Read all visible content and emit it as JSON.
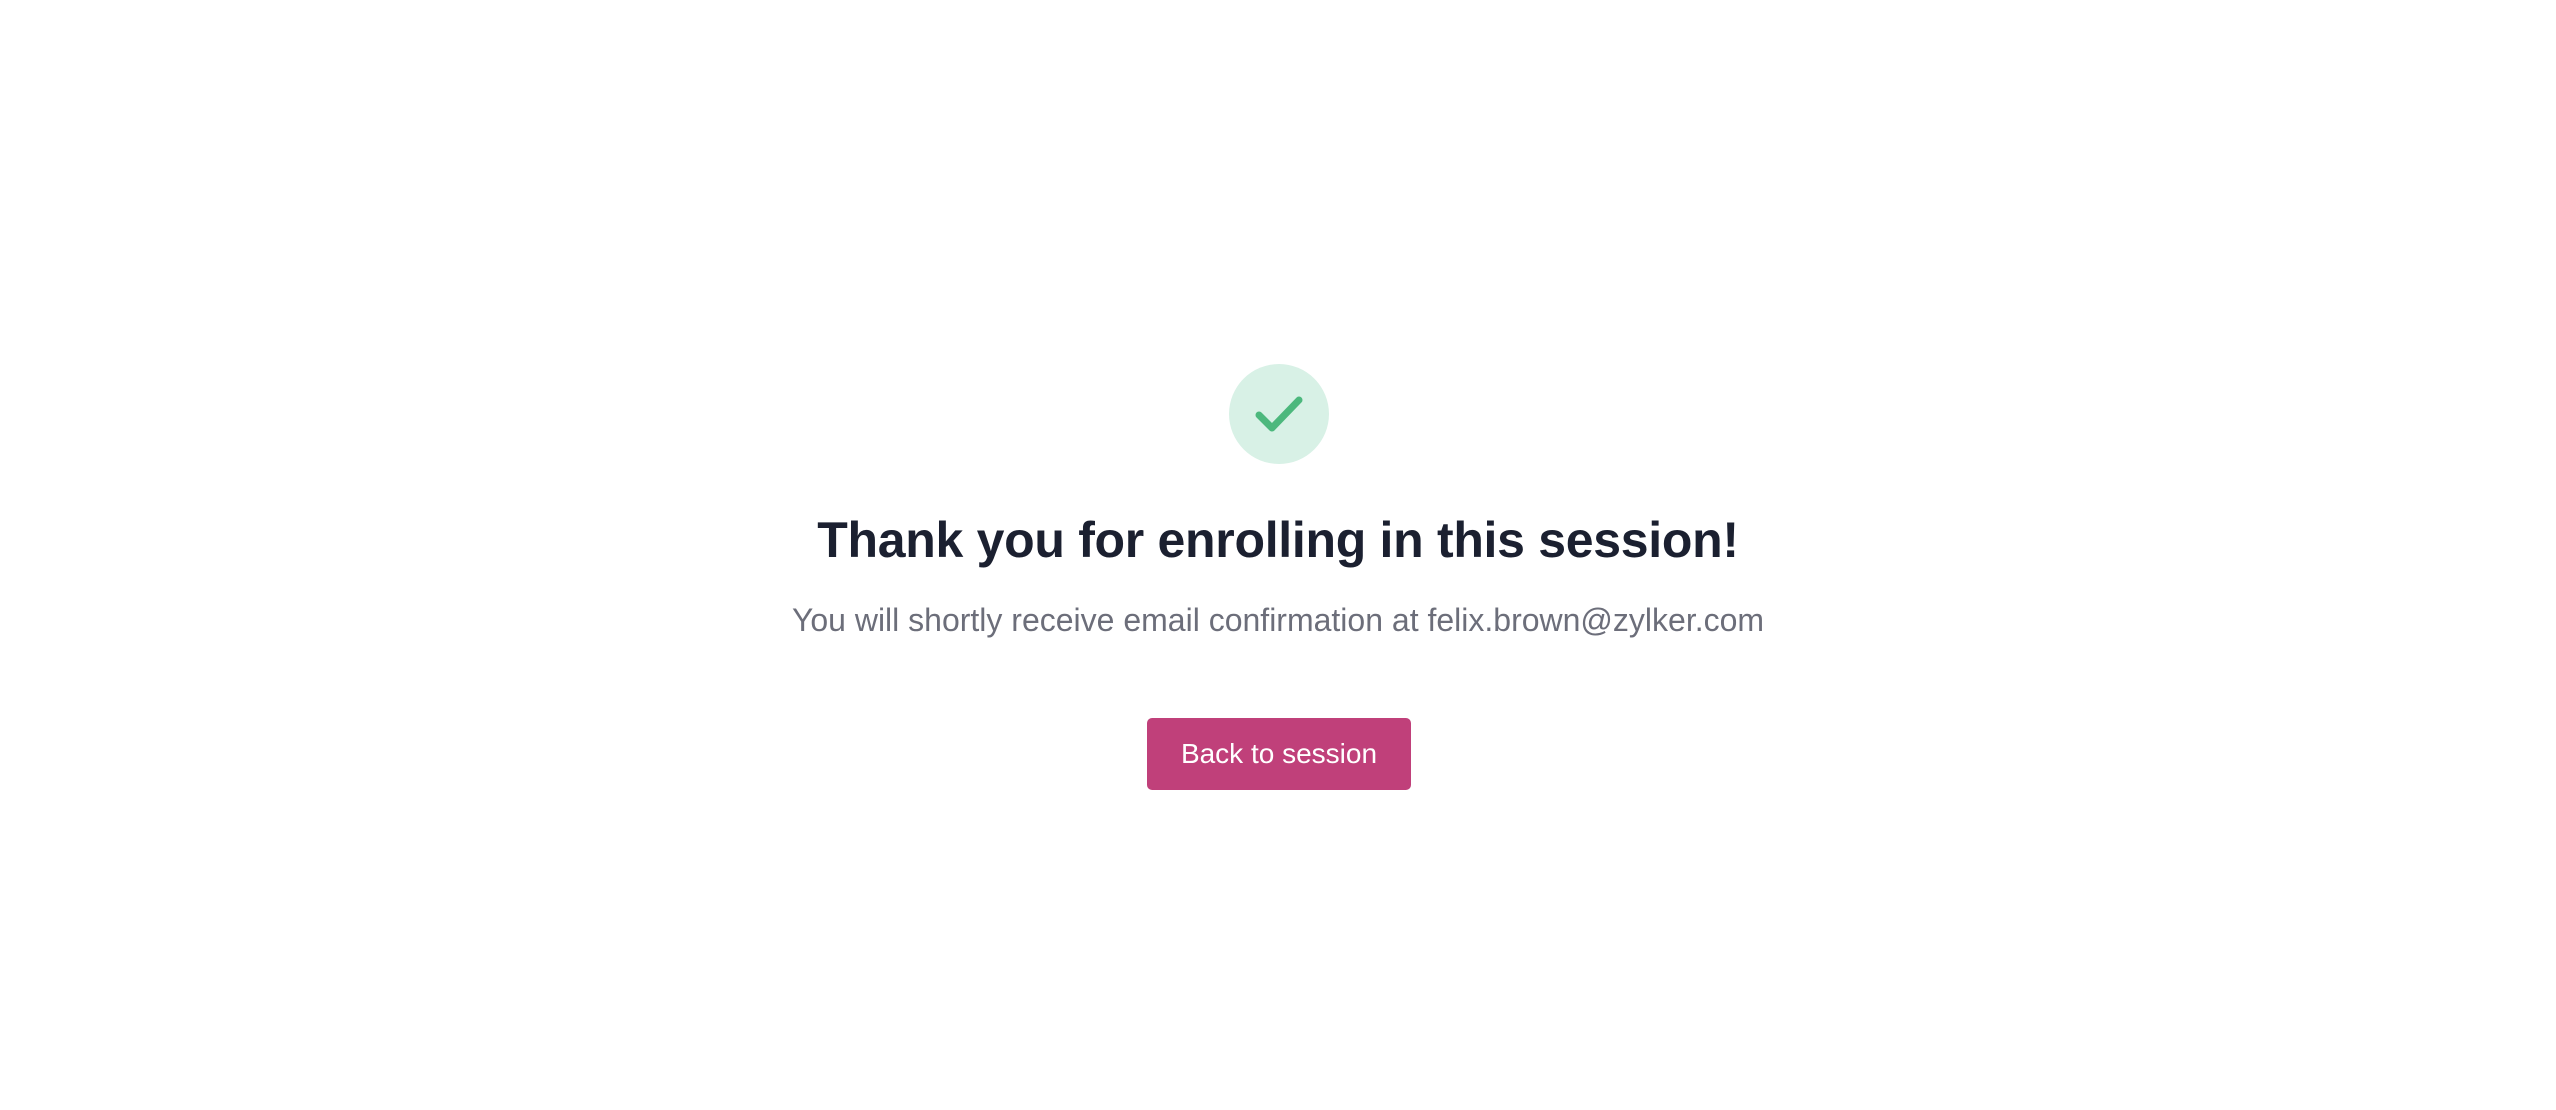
{
  "confirmation": {
    "icon": "check-icon",
    "title": "Thank you for enrolling in this session!",
    "message": "You will shortly receive email confirmation at",
    "email": "felix.brown@zylker.com",
    "back_button_label": "Back to session"
  },
  "colors": {
    "icon_background": "#d8f1e6",
    "icon_check": "#4cb87d",
    "title": "#1b2030",
    "message": "#6c6e7a",
    "button": "#c0407a",
    "button_text": "#ffffff"
  }
}
